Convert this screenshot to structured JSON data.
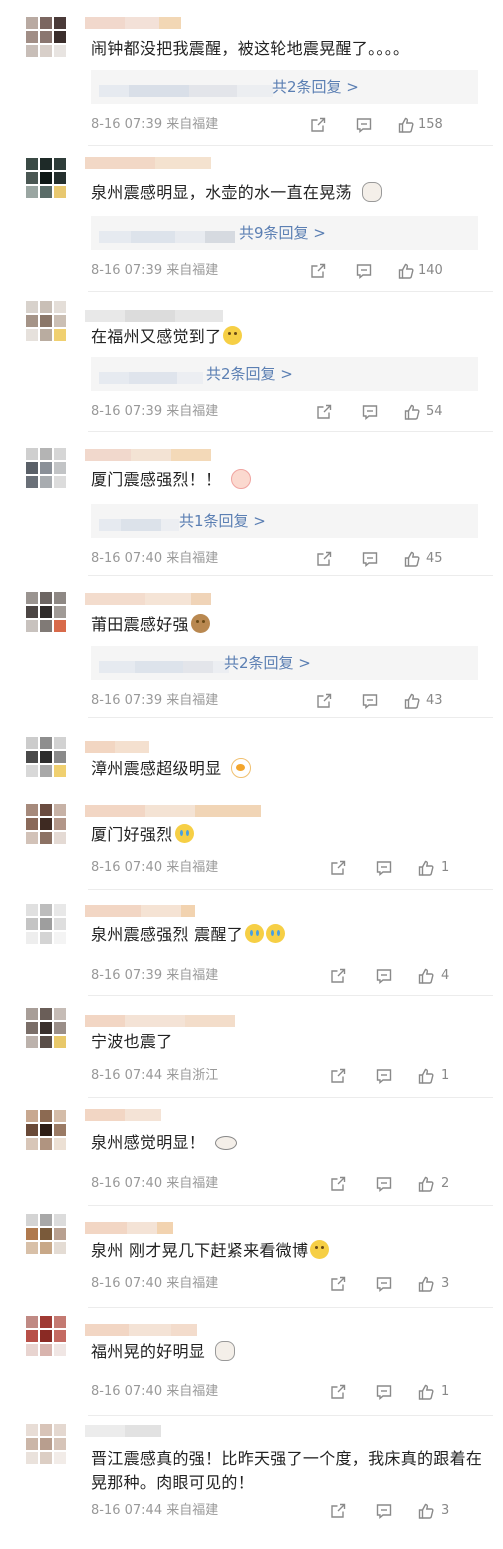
{
  "colors": {
    "link": "#5b7fb3",
    "meta": "#999999",
    "reply_bg": "#f5f5f5"
  },
  "icons": {
    "share": "share-icon",
    "comment": "comment-icon",
    "like": "thumbs-up-icon"
  },
  "comments": [
    {
      "text": "闹钟都没把我震醒，被这轮地震晃醒了。。。。",
      "reply_label": "共2条回复 >",
      "time": "8-16 07:39",
      "location": "来自福建",
      "likes": "158"
    },
    {
      "text": "泉州震感明显，水壶的水一直在晃荡",
      "reply_label": "共9条回复 >",
      "time": "8-16 07:39",
      "location": "来自福建",
      "likes": "140"
    },
    {
      "text": "在福州又感觉到了",
      "reply_label": "共2条回复 >",
      "time": "8-16 07:39",
      "location": "来自福建",
      "likes": "54"
    },
    {
      "text": "厦门震感强烈！！",
      "reply_label": "共1条回复 >",
      "time": "8-16 07:40",
      "location": "来自福建",
      "likes": "45"
    },
    {
      "text": "莆田震感好强",
      "reply_label": "共2条回复 >",
      "time": "8-16 07:39",
      "location": "来自福建",
      "likes": "43"
    },
    {
      "text": "漳州震感超级明显",
      "time": "",
      "location": "",
      "likes": ""
    },
    {
      "text": "厦门好强烈",
      "time": "8-16 07:40",
      "location": "来自福建",
      "likes": "1"
    },
    {
      "text": "泉州震感强烈  震醒了",
      "time": "8-16 07:39",
      "location": "来自福建",
      "likes": "4"
    },
    {
      "text": "宁波也震了",
      "time": "8-16 07:44",
      "location": "来自浙江",
      "likes": "1"
    },
    {
      "text": "泉州感觉明显！",
      "time": "8-16 07:40",
      "location": "来自福建",
      "likes": "2"
    },
    {
      "text": "泉州 刚才晃几下赶紧来看微博",
      "time": "8-16 07:40",
      "location": "来自福建",
      "likes": "3"
    },
    {
      "text": "福州晃的好明显",
      "time": "8-16 07:40",
      "location": "来自福建",
      "likes": "1"
    },
    {
      "text": "晋江震感真的强！比昨天强了一个度，我床真的跟着在晃那种。肉眼可见的！",
      "time": "8-16 07:44",
      "location": "来自福建",
      "likes": "3"
    }
  ]
}
